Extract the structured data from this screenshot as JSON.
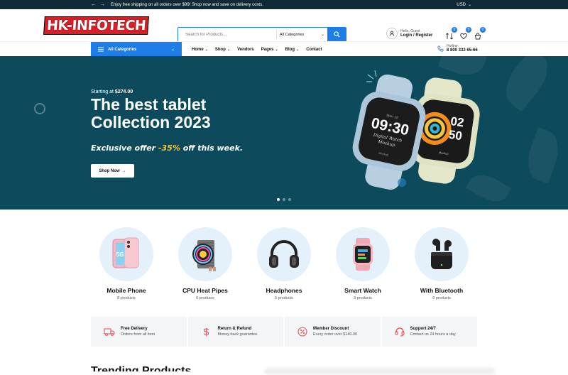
{
  "topbar": {
    "message": "Enjoy free shipping on all orders over $99! Shop now and save on delivery costs.",
    "currency": "USD"
  },
  "header": {
    "logo": "HK-INFOTECH",
    "search": {
      "placeholder": "Search for Products...",
      "category": "All Categories"
    },
    "user": {
      "greeting": "Hello, Guest",
      "action": "Login / Register"
    },
    "badges": {
      "compare": "0",
      "wishlist": "0",
      "cart": "0"
    }
  },
  "nav": {
    "all_categories": "All Categories",
    "menu": [
      {
        "label": "Home"
      },
      {
        "label": "Shop"
      },
      {
        "label": "Vendors"
      },
      {
        "label": "Pages"
      },
      {
        "label": "Blog"
      },
      {
        "label": "Contact"
      }
    ],
    "hotline_label": "Hotline:",
    "hotline_number": "8 800 332 65-66"
  },
  "hero": {
    "starting_prefix": "Starting at",
    "starting_price": "$274.00",
    "title_line1": "The best tablet",
    "title_line2": "Collection 2023",
    "offer_prefix": "Exclusive offer",
    "offer_pct": "-35%",
    "offer_suffix": "off this week.",
    "button": "Shop Now",
    "watch_left_time": "09:30",
    "watch_left_date": "Mon 12",
    "watch_left_sub1": "Digital Watch",
    "watch_left_sub2": "Mockup",
    "watch_left_foot": "Mockup",
    "watch_right_hour": "02",
    "watch_right_min": "50",
    "watch_right_foot": "Mockup"
  },
  "categories": [
    {
      "name": "Mobile Phone",
      "count": "8 products",
      "icon": "phone-icon"
    },
    {
      "name": "CPU Heat Pipes",
      "count": "6 products",
      "icon": "cpu-cooler-icon"
    },
    {
      "name": "Headphones",
      "count": "5 products",
      "icon": "headphones-icon"
    },
    {
      "name": "Smart Watch",
      "count": "3 products",
      "icon": "smartwatch-icon"
    },
    {
      "name": "With Bluetooth",
      "count": "9 products",
      "icon": "earbuds-icon"
    }
  ],
  "features": [
    {
      "title": "Free Delivery",
      "sub": "Orders from all item",
      "icon": "truck-icon"
    },
    {
      "title": "Return & Refund",
      "sub": "Money back guarantee",
      "icon": "dollar-icon"
    },
    {
      "title": "Member Discount",
      "sub": "Every order over $140.00",
      "icon": "percent-icon"
    },
    {
      "title": "Support 24/7",
      "sub": "Contact us 24 hours a day",
      "icon": "headset-icon"
    }
  ],
  "trending_title": "Trending Products",
  "colors": {
    "accent": "#1c7ee6",
    "hero_bg": "#0d4b5c",
    "offer": "#f2c53d",
    "feature_icon": "#e5484d"
  }
}
